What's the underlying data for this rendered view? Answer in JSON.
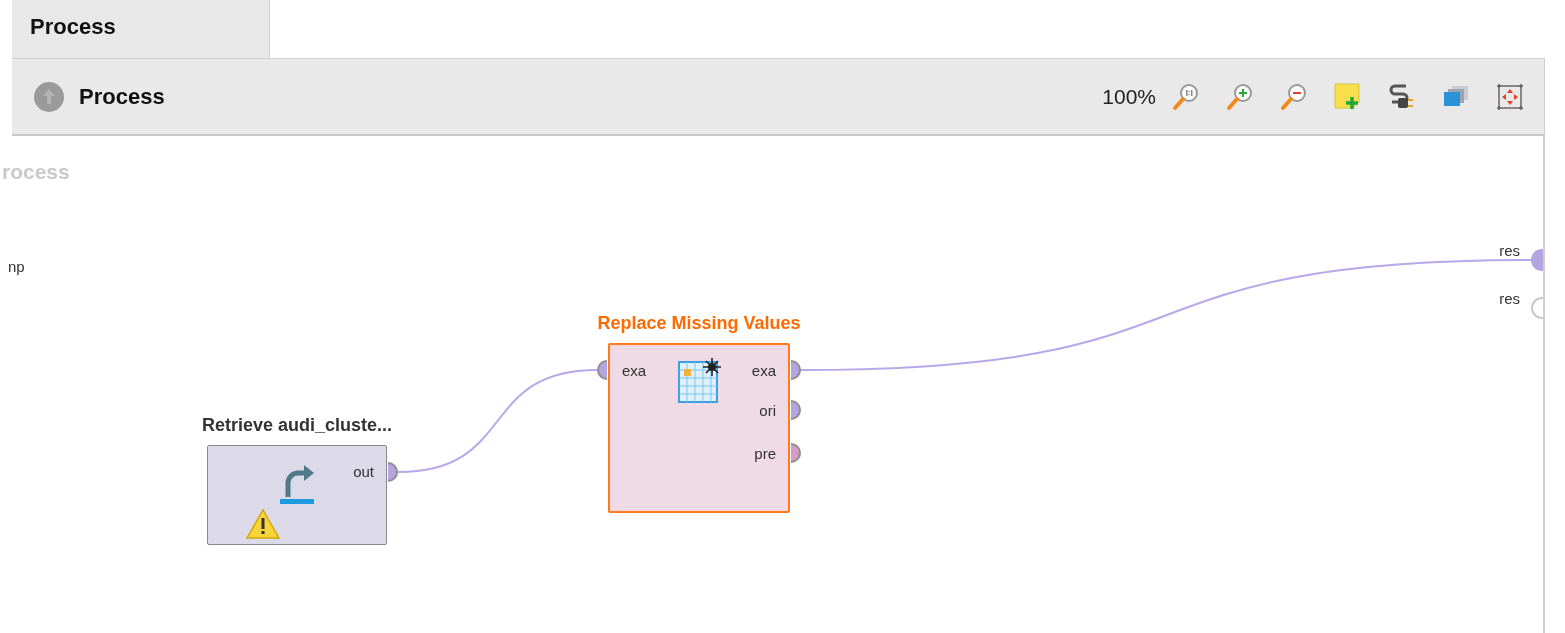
{
  "tabs": [
    {
      "label": "Process",
      "selected": true
    }
  ],
  "toolbar": {
    "title": "Process",
    "zoom": "100%"
  },
  "canvas": {
    "process_label": "rocess",
    "input_port_label": "np",
    "result_ports": [
      {
        "label": "res",
        "connected": true
      },
      {
        "label": "res",
        "connected": false
      }
    ],
    "operators": [
      {
        "name": "Retrieve audi_cluste...",
        "kind": "retrieve",
        "selected": false,
        "warning": true,
        "outputs": [
          {
            "label": "out",
            "color": "#b3a6e0"
          }
        ]
      },
      {
        "name": "Replace Missing Values",
        "kind": "replace",
        "selected": true,
        "warning": false,
        "inputs": [
          {
            "label": "exa",
            "color": "#b3a6e0"
          }
        ],
        "outputs": [
          {
            "label": "exa",
            "color": "#b3a6e0"
          },
          {
            "label": "ori",
            "color": "#b3a6e0"
          },
          {
            "label": "pre",
            "color": "#d79cc3"
          }
        ]
      }
    ]
  }
}
